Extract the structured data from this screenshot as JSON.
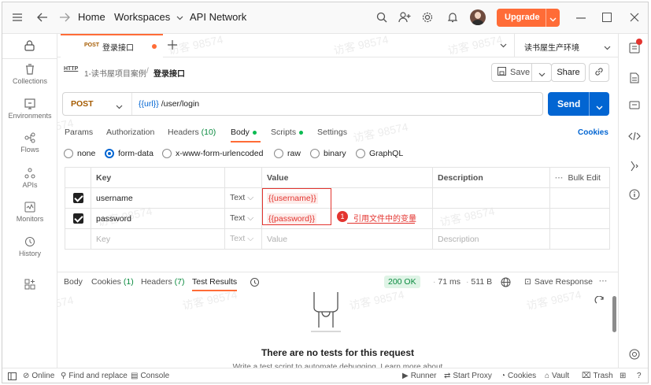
{
  "header": {
    "home": "Home",
    "workspaces": "Workspaces",
    "api_network": "API Network",
    "upgrade": "Upgrade"
  },
  "sidebar": {
    "items": [
      {
        "label": "Collections"
      },
      {
        "label": "Environments"
      },
      {
        "label": "Flows"
      },
      {
        "label": "APIs"
      },
      {
        "label": "Monitors"
      },
      {
        "label": "History"
      }
    ]
  },
  "tab": {
    "method": "POST",
    "name": "登录接口",
    "environment": "读书屋生产环境"
  },
  "breadcrumb": {
    "badge": "HTTP",
    "collection": "1-读书屋项目案例",
    "separator": "/",
    "current": "登录接口"
  },
  "actions": {
    "save": "Save",
    "share": "Share"
  },
  "request": {
    "method": "POST",
    "url_var": "{{url}}",
    "url_path": "/user/login",
    "send": "Send"
  },
  "req_tabs": {
    "params": "Params",
    "authorization": "Authorization",
    "headers": "Headers",
    "headers_count": "(10)",
    "body": "Body",
    "scripts": "Scripts",
    "settings": "Settings",
    "cookies": "Cookies"
  },
  "body_types": [
    "none",
    "form-data",
    "x-www-form-urlencoded",
    "raw",
    "binary",
    "GraphQL"
  ],
  "table": {
    "headers": {
      "key": "Key",
      "value": "Value",
      "description": "Description",
      "bulk_edit": "Bulk Edit"
    },
    "rows": [
      {
        "key": "username",
        "type": "Text",
        "value": "{{username}}",
        "description": ""
      },
      {
        "key": "password",
        "type": "Text",
        "value": "{{password}}",
        "description": ""
      }
    ],
    "placeholder": {
      "key": "Key",
      "type": "Text",
      "value": "Value",
      "description": "Description"
    }
  },
  "annotation": {
    "number": "1",
    "text": "引用文件中的变量"
  },
  "response": {
    "tabs": {
      "body": "Body",
      "cookies": "Cookies",
      "cookies_count": "(1)",
      "headers": "Headers",
      "headers_count": "(7)",
      "test_results": "Test Results"
    },
    "status": "200 OK",
    "time": "71 ms",
    "size": "511 B",
    "save_response": "Save Response",
    "empty_title": "There are no tests for this request",
    "empty_sub": "Write a test script to automate debugging. Learn more about"
  },
  "statusbar": {
    "online": "Online",
    "find_replace": "Find and replace",
    "console": "Console",
    "runner": "Runner",
    "start_proxy": "Start Proxy",
    "cookies": "Cookies",
    "vault": "Vault",
    "trash": "Trash"
  },
  "watermark": "访客 98574",
  "colors": {
    "accent_orange": "#ff6c37",
    "send_blue": "#0265d2",
    "status_green": "#0a8a3f",
    "annotation_red": "#e3342f"
  }
}
